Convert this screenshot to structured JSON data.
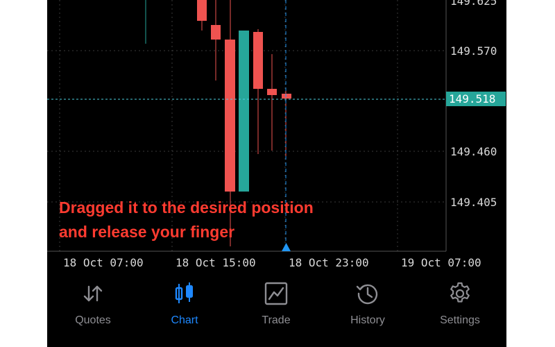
{
  "price_axis": {
    "labels": [
      "149.625",
      "149.570",
      "149.460",
      "149.405"
    ],
    "current_price": "149.518"
  },
  "time_axis": {
    "labels": [
      "18 Oct 07:00",
      "18 Oct 15:00",
      "18 Oct 23:00",
      "19 Oct 07:00"
    ]
  },
  "annotation": {
    "line1": "Dragged it to the desired position",
    "line2": "and release your finger"
  },
  "colors": {
    "bull": "#26a69a",
    "bear": "#ef5350",
    "active_tab": "#1e88ff",
    "inactive_tab": "#8e8e93",
    "annotation": "#ff3b30"
  },
  "tabbar": {
    "tabs": [
      {
        "label": "Quotes",
        "icon": "quotes-arrows-icon",
        "active": false
      },
      {
        "label": "Chart",
        "icon": "candlestick-chart-icon",
        "active": true
      },
      {
        "label": "Trade",
        "icon": "trade-chart-icon",
        "active": false
      },
      {
        "label": "History",
        "icon": "history-clock-icon",
        "active": false
      },
      {
        "label": "Settings",
        "icon": "gear-icon",
        "active": false
      }
    ]
  }
}
